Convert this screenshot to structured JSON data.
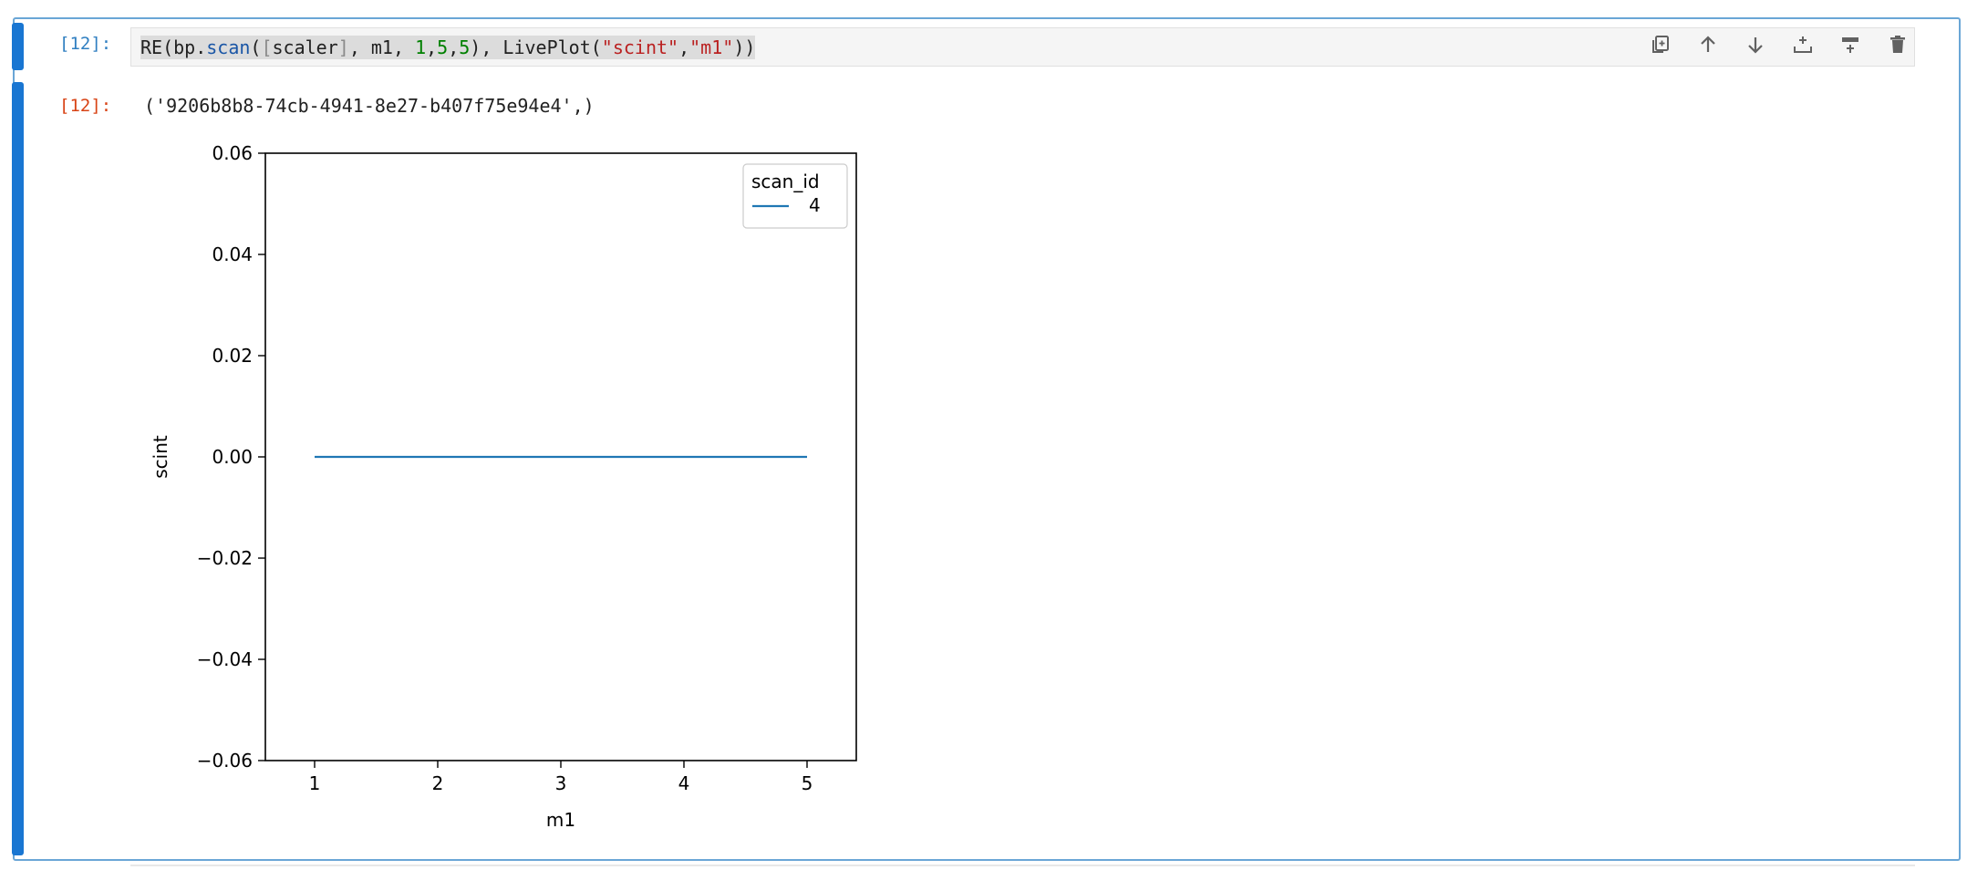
{
  "input_cell": {
    "prompt": "[12]:",
    "code_tokens": [
      {
        "t": "RE(bp.",
        "c": ""
      },
      {
        "t": "scan",
        "c": "tok-attr"
      },
      {
        "t": "(",
        "c": ""
      },
      {
        "t": "[",
        "c": "tok-bracket"
      },
      {
        "t": "scaler",
        "c": ""
      },
      {
        "t": "]",
        "c": "tok-bracket"
      },
      {
        "t": ", m1, ",
        "c": ""
      },
      {
        "t": "1",
        "c": "tok-num"
      },
      {
        "t": ",",
        "c": ""
      },
      {
        "t": "5",
        "c": "tok-num"
      },
      {
        "t": ",",
        "c": ""
      },
      {
        "t": "5",
        "c": "tok-num"
      },
      {
        "t": "), LivePlot(",
        "c": ""
      },
      {
        "t": "\"scint\"",
        "c": "tok-str"
      },
      {
        "t": ",",
        "c": ""
      },
      {
        "t": "\"m1\"",
        "c": "tok-str"
      },
      {
        "t": "))",
        "c": ""
      }
    ]
  },
  "toolbar": {
    "buttons": [
      {
        "name": "duplicate-cell-button",
        "icon": "copy-icon"
      },
      {
        "name": "move-cell-up-button",
        "icon": "arrow-up-icon"
      },
      {
        "name": "move-cell-down-button",
        "icon": "arrow-down-icon"
      },
      {
        "name": "insert-cell-above-button",
        "icon": "insert-above-icon"
      },
      {
        "name": "insert-cell-below-button",
        "icon": "insert-below-icon"
      },
      {
        "name": "delete-cell-button",
        "icon": "trash-icon"
      }
    ]
  },
  "output_cell": {
    "prompt": "[12]:",
    "text": "('9206b8b8-74cb-4941-8e27-b407f75e94e4',)"
  },
  "chart_data": {
    "type": "line",
    "xlabel": "m1",
    "ylabel": "scint",
    "xlim": [
      0.6,
      5.4
    ],
    "ylim": [
      -0.06,
      0.06
    ],
    "xticks": [
      1,
      2,
      3,
      4,
      5
    ],
    "xtick_labels": [
      "1",
      "2",
      "3",
      "4",
      "5"
    ],
    "yticks": [
      -0.06,
      -0.04,
      -0.02,
      0.0,
      0.02,
      0.04,
      0.06
    ],
    "ytick_labels": [
      "−0.06",
      "−0.04",
      "−0.02",
      "0.00",
      "0.02",
      "0.04",
      "0.06"
    ],
    "grid": false,
    "legend": {
      "title": "scan_id",
      "placement": "top-right"
    },
    "series": [
      {
        "name": "4",
        "color": "#1f77b4",
        "x": [
          1,
          2,
          3,
          4,
          5
        ],
        "y": [
          0,
          0,
          0,
          0,
          0
        ]
      }
    ]
  }
}
